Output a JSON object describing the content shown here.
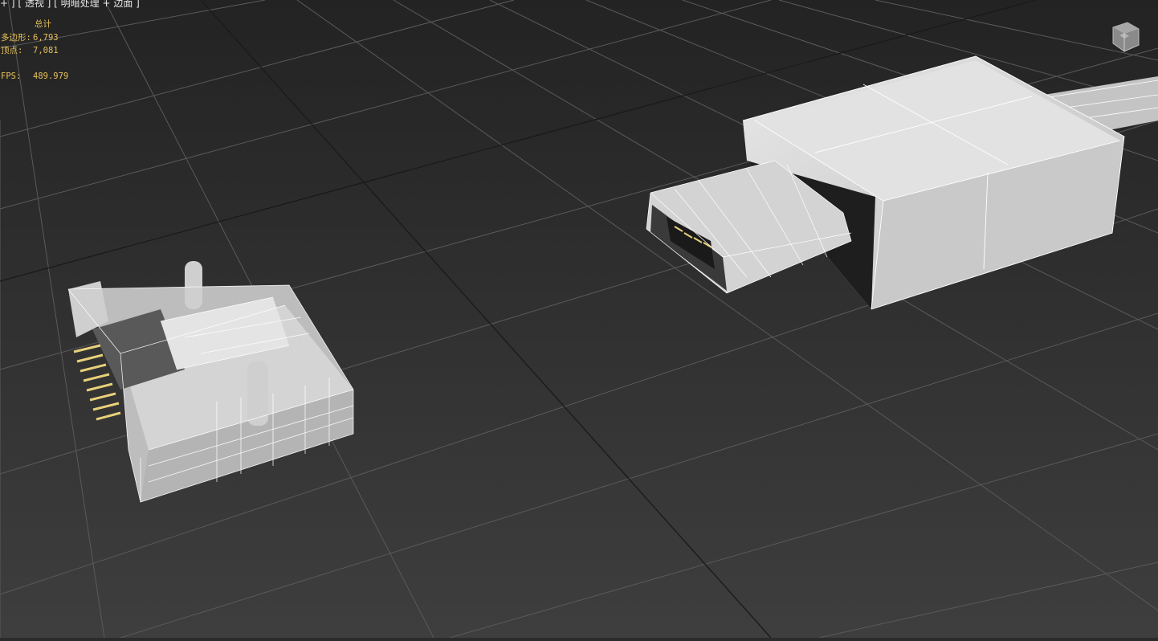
{
  "viewport": {
    "label": "+ ] [ 透视 ] [ 明暗处理 + 边面 ]"
  },
  "stats": {
    "header": "总计",
    "polys_label": "多边形:",
    "polys_value": "6,793",
    "verts_label": "顶点:",
    "verts_value": "7,081",
    "fps_label": "FPS:",
    "fps_value": "489.979"
  },
  "colors": {
    "background": "#2b2b2b",
    "grid": "#5a5a5a",
    "stats_text": "#e6c15a",
    "model_fill": "#c8c8c8",
    "wire": "#ffffff",
    "pins": "#e8d17a"
  },
  "icons": {
    "viewcube": "viewcube-icon"
  }
}
